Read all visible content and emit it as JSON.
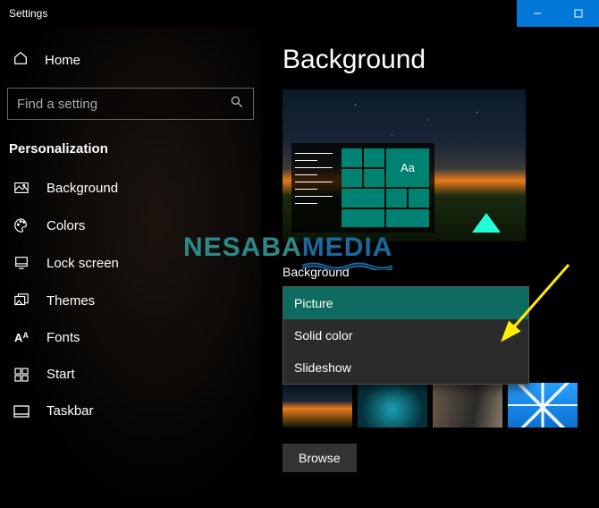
{
  "window": {
    "title": "Settings"
  },
  "sidebar": {
    "home": "Home",
    "search_placeholder": "Find a setting",
    "category": "Personalization",
    "items": [
      {
        "label": "Background",
        "icon": "image-icon"
      },
      {
        "label": "Colors",
        "icon": "palette-icon"
      },
      {
        "label": "Lock screen",
        "icon": "lockscreen-icon"
      },
      {
        "label": "Themes",
        "icon": "themes-icon"
      },
      {
        "label": "Fonts",
        "icon": "fonts-icon"
      },
      {
        "label": "Start",
        "icon": "start-icon"
      },
      {
        "label": "Taskbar",
        "icon": "taskbar-icon"
      }
    ]
  },
  "main": {
    "title": "Background",
    "preview_sample_text": "Aa",
    "field_label": "Background",
    "dropdown": {
      "selected": "Picture",
      "options": [
        "Picture",
        "Solid color",
        "Slideshow"
      ]
    },
    "browse": "Browse"
  },
  "watermark": {
    "part1": "NESABA",
    "part2": "MEDIA"
  },
  "colors": {
    "accent": "#008272",
    "window_button": "#0078d7"
  }
}
